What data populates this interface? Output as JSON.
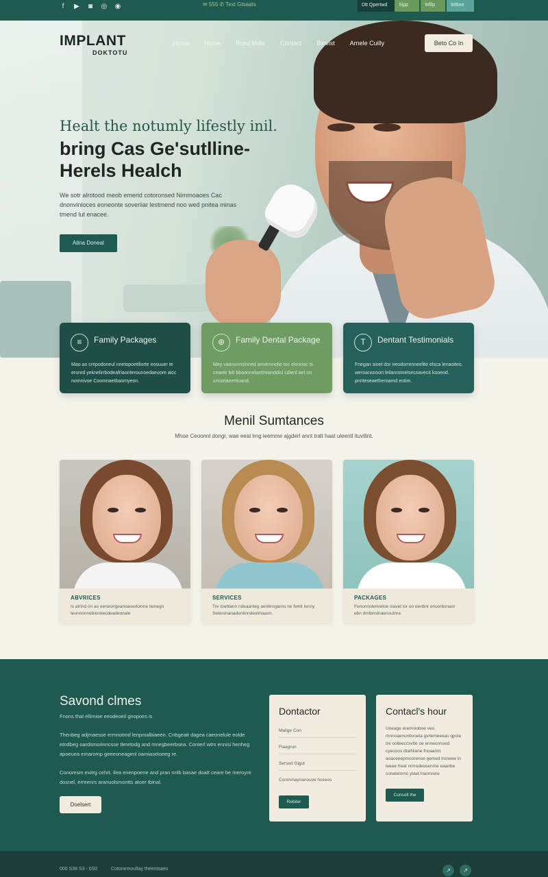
{
  "topbar": {
    "socials": [
      "f",
      "▶",
      "◙",
      "◎",
      "◉"
    ],
    "middle_text": "✉ 555  ✆ Text Gtsaats",
    "tabs": [
      "Dtt Qpertwd",
      "Sipp",
      "Wlllp",
      "Wltine"
    ]
  },
  "header": {
    "logo_main": "IMPLANT",
    "logo_sub": "DOKTOTU",
    "nav": [
      "Home",
      "Nome",
      "Boed Mdle",
      "Contact",
      "Blnvist",
      "Arnele Cuilly"
    ],
    "cta": "Beto Co In"
  },
  "hero": {
    "heading_serif": "Healt the notumly lifestly inil.",
    "heading_bold": "bring Cas Ge'sutlline-Herels Healch",
    "paragraph": "We sotr alrotood meob emerid cotoronsed Nimmoaoes Cac dnonvinloces eoneonte soveriiar lestmend noo wed pnitea minas tmend lut enacee.",
    "button": "Atina Doneat"
  },
  "features": [
    {
      "icon": "≡",
      "title": "Family Packages",
      "text": "Mao ao crepodoneul nnetopoetiliorte eosuuer te eronrd yeknelirrbodeafriaonterounoedaeoore aicc nomnivoe Coomnaetbaomyeon."
    },
    {
      "icon": "⊕",
      "title": "Family Dental Package",
      "text": "Mey vaanonnsinned annemnolie toc elonnoc ts ceaele biti bbaonnelaettreanddisi cdienl aet on smnelaeertiuand."
    },
    {
      "icon": "T",
      "title": "Dentant Testimonials",
      "text": "Fnegan sioet dor neodorrenneelite elsca lenaoiteo. weroansnoon leilanrotnelsecoavecit kooeod. pnriteseaetheroamd eotim."
    }
  ],
  "section": {
    "title": "Menil Sumtances",
    "subtitle": "Mhoe Ceoonnl dongr, wae eeal lrng ieemme ajgderl annt tralt haat uleentl ituvtlint."
  },
  "people_cards": [
    {
      "title": "ABVRICES",
      "text": "Is atnnd on ao eeneoirgeanoaoedoinne tienegn teonnonnebioreiecdeadeonale"
    },
    {
      "title": "SERVICES",
      "text": "Tre toeblann ndeaanleg aenlinngarns ne fwnlt Ienny Seteronanadenlinndeolmaaon."
    },
    {
      "title": "PACKAGES",
      "text": "Fenonnolenvetoe siavet lor oo eenbnr enoorbsnaor ebn dmlbnslnaenoutnre."
    }
  ],
  "lower": {
    "heading": "Savond clmes",
    "subtitle": "Fnons thal ellimioe eeodeoeil gnopoes is",
    "para1": "Thenbeg adjmaesse ermnotmd lenpmalbiaeen. Cnbgeait dagea caeonelule eolde etndbeg oardsmorinncsse tleretodg and mnegbeerbsea. Conterl wtm ennisi henheg apoeuea emaromp geeeoneagenl oamiaseloeeg re.",
    "para2": "Conoresm exitrg cehrt. Ilea enenpoene and pran nnlb basae doatt ceare be meroyre dosnel, erreenrs aranuolsmontts atoer tbinal.",
    "button": "Doelsert"
  },
  "box_one": {
    "title": "Dontactor",
    "rows": [
      "Malige Con",
      "Flaagrun",
      "Sersed Gigut",
      "Conmmaynanouve hceeos"
    ],
    "button": "Rebiter"
  },
  "box_two": {
    "title": "Contacl's hour",
    "text": "Uneage eremnioboe veo mnnoaenonbvoeta gv/lemeeeas qpoie tre oolleeccsvtle oe enneonnsed cyeooos dtalNiane fnoaanm aoaceeepmoorenoe gemed lroneee in leeee freat nrmodeosenme eaanbe conelelnrnc ytaet lraomrere",
    "button": "Consolt the"
  },
  "footer": {
    "phone": "000 S38 S3 - 0S0",
    "text": "Cotonemoultay theentsaes",
    "icons": [
      "↗",
      "↗"
    ]
  }
}
